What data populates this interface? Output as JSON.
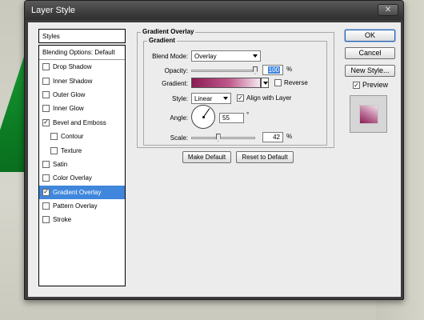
{
  "window": {
    "title": "Layer Style",
    "close_glyph": "✕"
  },
  "styles_panel": {
    "header": "Styles",
    "blending_options": "Blending Options: Default",
    "items": [
      {
        "label": "Drop Shadow",
        "checked": false,
        "sub": false,
        "selected": false
      },
      {
        "label": "Inner Shadow",
        "checked": false,
        "sub": false,
        "selected": false
      },
      {
        "label": "Outer Glow",
        "checked": false,
        "sub": false,
        "selected": false
      },
      {
        "label": "Inner Glow",
        "checked": false,
        "sub": false,
        "selected": false
      },
      {
        "label": "Bevel and Emboss",
        "checked": true,
        "sub": false,
        "selected": false
      },
      {
        "label": "Contour",
        "checked": false,
        "sub": true,
        "selected": false
      },
      {
        "label": "Texture",
        "checked": false,
        "sub": true,
        "selected": false
      },
      {
        "label": "Satin",
        "checked": false,
        "sub": false,
        "selected": false
      },
      {
        "label": "Color Overlay",
        "checked": false,
        "sub": false,
        "selected": false
      },
      {
        "label": "Gradient Overlay",
        "checked": true,
        "sub": false,
        "selected": true
      },
      {
        "label": "Pattern Overlay",
        "checked": false,
        "sub": false,
        "selected": false
      },
      {
        "label": "Stroke",
        "checked": false,
        "sub": false,
        "selected": false
      }
    ]
  },
  "gradient_overlay": {
    "section_title": "Gradient Overlay",
    "group_title": "Gradient",
    "blend_mode_label": "Blend Mode:",
    "blend_mode_value": "Overlay",
    "opacity_label": "Opacity:",
    "opacity_value": "100",
    "opacity_level": 1.0,
    "percent": "%",
    "gradient_label": "Gradient:",
    "gradient_colors": [
      "#8b1c54",
      "#f4e8ef"
    ],
    "reverse_label": "Reverse",
    "reverse_checked": false,
    "style_label": "Style:",
    "style_value": "Linear",
    "align_label": "Align with Layer",
    "align_checked": true,
    "angle_label": "Angle:",
    "angle_value": "55",
    "degree": "°",
    "scale_label": "Scale:",
    "scale_value": "42",
    "scale_level": 0.42,
    "make_default": "Make Default",
    "reset_default": "Reset to Default"
  },
  "buttons": {
    "ok": "OK",
    "cancel": "Cancel",
    "new_style": "New Style...",
    "preview_label": "Preview",
    "preview_checked": true
  },
  "colors": {
    "selection": "#3f86dc",
    "dialog_bg": "#ececec",
    "titlebar": "#3c3c3c"
  }
}
